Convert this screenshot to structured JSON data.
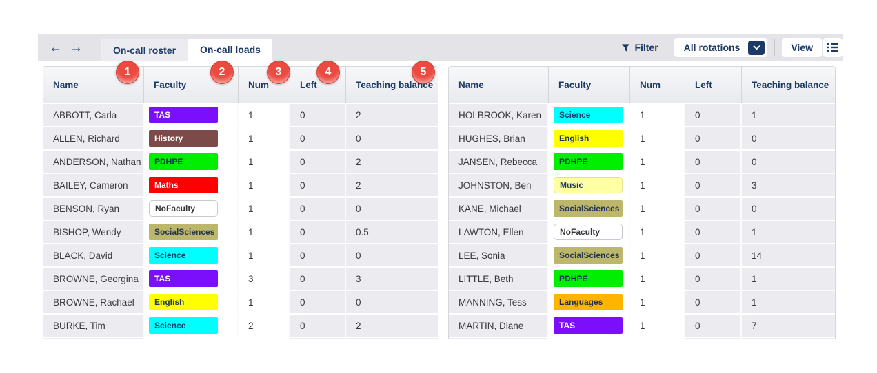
{
  "toolbar": {
    "back_icon": "←",
    "forward_icon": "→",
    "tabs": [
      {
        "label": "On-call roster",
        "active": false
      },
      {
        "label": "On-call loads",
        "active": true
      }
    ],
    "filter_label": "Filter",
    "rotation_selector": {
      "value": "All rotations"
    },
    "view_label": "View"
  },
  "annotations": {
    "labels": [
      "1",
      "2",
      "3",
      "4",
      "5"
    ]
  },
  "columns": [
    "Name",
    "Faculty",
    "Num",
    "Left",
    "Teaching balance"
  ],
  "tables": {
    "left": {
      "rows": [
        {
          "name": "ABBOTT, Carla",
          "faculty": "TAS",
          "num": "1",
          "left": "0",
          "balance": "2"
        },
        {
          "name": "ALLEN, Richard",
          "faculty": "History",
          "num": "1",
          "left": "0",
          "balance": "0"
        },
        {
          "name": "ANDERSON, Nathan",
          "faculty": "PDHPE",
          "num": "1",
          "left": "0",
          "balance": "2"
        },
        {
          "name": "BAILEY, Cameron",
          "faculty": "Maths",
          "num": "1",
          "left": "0",
          "balance": "2"
        },
        {
          "name": "BENSON, Ryan",
          "faculty": "NoFaculty",
          "num": "1",
          "left": "0",
          "balance": "0"
        },
        {
          "name": "BISHOP, Wendy",
          "faculty": "SocialSciences",
          "num": "1",
          "left": "0",
          "balance": "0.5"
        },
        {
          "name": "BLACK, David",
          "faculty": "Science",
          "num": "1",
          "left": "0",
          "balance": "0"
        },
        {
          "name": "BROWNE, Georgina",
          "faculty": "TAS",
          "num": "3",
          "left": "0",
          "balance": "3"
        },
        {
          "name": "BROWNE, Rachael",
          "faculty": "English",
          "num": "1",
          "left": "0",
          "balance": "0"
        },
        {
          "name": "BURKE, Tim",
          "faculty": "Science",
          "num": "2",
          "left": "0",
          "balance": "2"
        }
      ]
    },
    "right": {
      "rows": [
        {
          "name": "HOLBROOK, Karen",
          "faculty": "Science",
          "num": "1",
          "left": "0",
          "balance": "1"
        },
        {
          "name": "HUGHES, Brian",
          "faculty": "English",
          "num": "1",
          "left": "0",
          "balance": "0"
        },
        {
          "name": "JANSEN, Rebecca",
          "faculty": "PDHPE",
          "num": "1",
          "left": "0",
          "balance": "0"
        },
        {
          "name": "JOHNSTON, Ben",
          "faculty": "Music",
          "num": "1",
          "left": "0",
          "balance": "3"
        },
        {
          "name": "KANE, Michael",
          "faculty": "SocialSciences",
          "num": "1",
          "left": "0",
          "balance": "0"
        },
        {
          "name": "LAWTON, Ellen",
          "faculty": "NoFaculty",
          "num": "1",
          "left": "0",
          "balance": "1"
        },
        {
          "name": "LEE, Sonia",
          "faculty": "SocialSciences",
          "num": "1",
          "left": "0",
          "balance": "14"
        },
        {
          "name": "LITTLE, Beth",
          "faculty": "PDHPE",
          "num": "1",
          "left": "0",
          "balance": "1"
        },
        {
          "name": "MANNING, Tess",
          "faculty": "Languages",
          "num": "1",
          "left": "0",
          "balance": "1"
        },
        {
          "name": "MARTIN, Diane",
          "faculty": "TAS",
          "num": "1",
          "left": "0",
          "balance": "7"
        }
      ]
    }
  },
  "faculty_styles": {
    "TAS": {
      "bg": "#7c0ffb",
      "fg": "#ffffff"
    },
    "History": {
      "bg": "#7d4a4a",
      "fg": "#ffffff"
    },
    "PDHPE": {
      "bg": "#00ee00",
      "fg": "#173052"
    },
    "Maths": {
      "bg": "#fd0000",
      "fg": "#ffffff"
    },
    "NoFaculty": {
      "bg": "#ffffff",
      "fg": "#333337",
      "border": "#c9c9cf"
    },
    "SocialSciences": {
      "bg": "#bdb76b",
      "fg": "#24344f"
    },
    "Science": {
      "bg": "#00ffff",
      "fg": "#1c3a66"
    },
    "English": {
      "bg": "#ffff00",
      "fg": "#1c3a66"
    },
    "Music": {
      "bg": "#ffffa3",
      "fg": "#1c3a66",
      "border": "#e0e090"
    },
    "Languages": {
      "bg": "#ffb400",
      "fg": "#203050"
    }
  },
  "colors": {
    "accent_navy": "#1c3a66",
    "toolbar_band": "#e3e3e8",
    "annotation_red": "#ea4a40",
    "row_shade": "#ebebf0"
  }
}
